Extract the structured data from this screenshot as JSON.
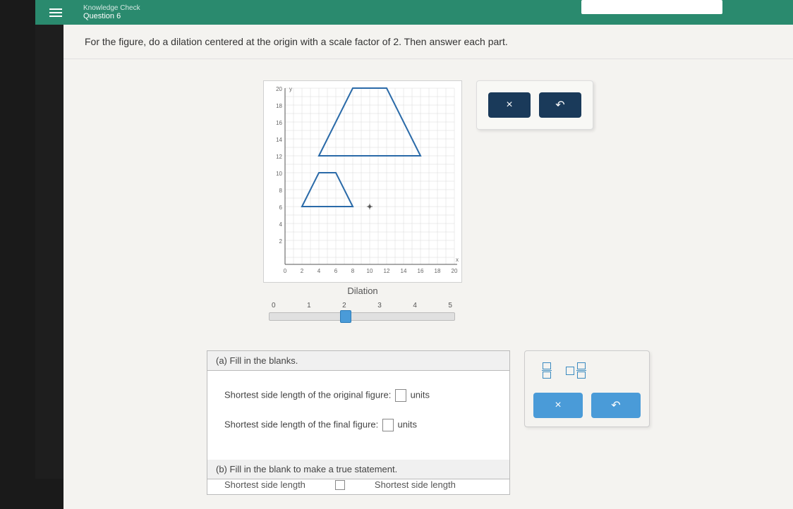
{
  "header": {
    "subtitle": "Knowledge Check",
    "title": "Question 6"
  },
  "question": "For the figure, do a dilation centered at the origin with a scale factor of 2. Then answer each part.",
  "graph": {
    "dilation_label": "Dilation",
    "slider_ticks": [
      "0",
      "1",
      "2",
      "3",
      "4",
      "5"
    ],
    "y_ticks": [
      "20",
      "18",
      "16",
      "14",
      "12",
      "10",
      "8",
      "6",
      "4",
      "2"
    ],
    "x_ticks": [
      "0",
      "2",
      "4",
      "6",
      "8",
      "10",
      "12",
      "14",
      "16",
      "18",
      "20"
    ]
  },
  "chart_data": {
    "type": "diagram",
    "title": "Dilation on coordinate grid",
    "xlabel": "x",
    "ylabel": "y",
    "xlim": [
      0,
      20
    ],
    "ylim": [
      0,
      20
    ],
    "original_figure": {
      "shape": "trapezoid",
      "vertices": [
        [
          2,
          6
        ],
        [
          4,
          10
        ],
        [
          6,
          10
        ],
        [
          8,
          6
        ]
      ]
    },
    "dilated_figure": {
      "shape": "trapezoid",
      "scale_factor": 2,
      "vertices": [
        [
          4,
          12
        ],
        [
          8,
          20
        ],
        [
          12,
          20
        ],
        [
          16,
          12
        ]
      ]
    },
    "point_marker": [
      10,
      6
    ],
    "slider": {
      "min": 0,
      "max": 5,
      "value": 2
    }
  },
  "actions": {
    "clear_icon": "×",
    "reset_icon": "↶"
  },
  "parts": {
    "a": {
      "header": "(a)  Fill in the blanks.",
      "line1_pre": "Shortest side length of the original figure:",
      "line1_post": "units",
      "line2_pre": "Shortest side length of the final figure:",
      "line2_post": "units"
    },
    "b": {
      "header": "(b)  Fill in the blank to make a true statement.",
      "cut_left": "Shortest side length",
      "cut_right": "Shortest side length"
    }
  },
  "tools": {
    "clear_icon": "×",
    "reset_icon": "↶"
  }
}
